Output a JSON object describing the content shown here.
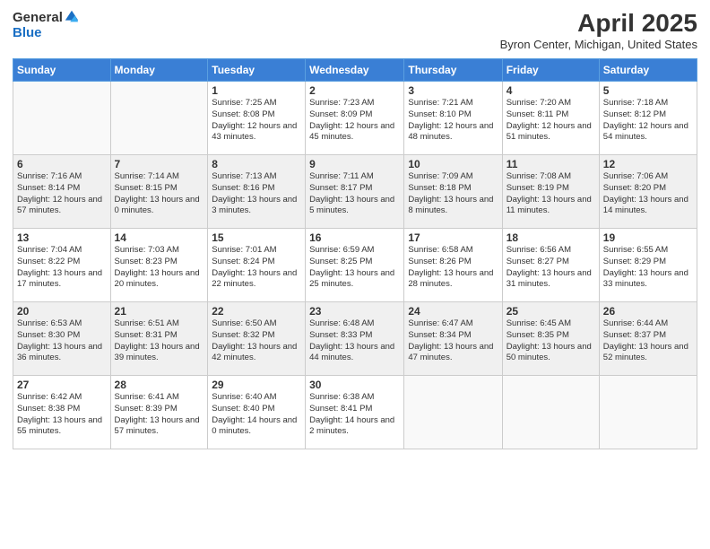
{
  "header": {
    "logo_general": "General",
    "logo_blue": "Blue",
    "title": "April 2025",
    "location": "Byron Center, Michigan, United States"
  },
  "days_of_week": [
    "Sunday",
    "Monday",
    "Tuesday",
    "Wednesday",
    "Thursday",
    "Friday",
    "Saturday"
  ],
  "weeks": [
    {
      "shaded": false,
      "days": [
        {
          "num": "",
          "info": ""
        },
        {
          "num": "",
          "info": ""
        },
        {
          "num": "1",
          "info": "Sunrise: 7:25 AM\nSunset: 8:08 PM\nDaylight: 12 hours and 43 minutes."
        },
        {
          "num": "2",
          "info": "Sunrise: 7:23 AM\nSunset: 8:09 PM\nDaylight: 12 hours and 45 minutes."
        },
        {
          "num": "3",
          "info": "Sunrise: 7:21 AM\nSunset: 8:10 PM\nDaylight: 12 hours and 48 minutes."
        },
        {
          "num": "4",
          "info": "Sunrise: 7:20 AM\nSunset: 8:11 PM\nDaylight: 12 hours and 51 minutes."
        },
        {
          "num": "5",
          "info": "Sunrise: 7:18 AM\nSunset: 8:12 PM\nDaylight: 12 hours and 54 minutes."
        }
      ]
    },
    {
      "shaded": true,
      "days": [
        {
          "num": "6",
          "info": "Sunrise: 7:16 AM\nSunset: 8:14 PM\nDaylight: 12 hours and 57 minutes."
        },
        {
          "num": "7",
          "info": "Sunrise: 7:14 AM\nSunset: 8:15 PM\nDaylight: 13 hours and 0 minutes."
        },
        {
          "num": "8",
          "info": "Sunrise: 7:13 AM\nSunset: 8:16 PM\nDaylight: 13 hours and 3 minutes."
        },
        {
          "num": "9",
          "info": "Sunrise: 7:11 AM\nSunset: 8:17 PM\nDaylight: 13 hours and 5 minutes."
        },
        {
          "num": "10",
          "info": "Sunrise: 7:09 AM\nSunset: 8:18 PM\nDaylight: 13 hours and 8 minutes."
        },
        {
          "num": "11",
          "info": "Sunrise: 7:08 AM\nSunset: 8:19 PM\nDaylight: 13 hours and 11 minutes."
        },
        {
          "num": "12",
          "info": "Sunrise: 7:06 AM\nSunset: 8:20 PM\nDaylight: 13 hours and 14 minutes."
        }
      ]
    },
    {
      "shaded": false,
      "days": [
        {
          "num": "13",
          "info": "Sunrise: 7:04 AM\nSunset: 8:22 PM\nDaylight: 13 hours and 17 minutes."
        },
        {
          "num": "14",
          "info": "Sunrise: 7:03 AM\nSunset: 8:23 PM\nDaylight: 13 hours and 20 minutes."
        },
        {
          "num": "15",
          "info": "Sunrise: 7:01 AM\nSunset: 8:24 PM\nDaylight: 13 hours and 22 minutes."
        },
        {
          "num": "16",
          "info": "Sunrise: 6:59 AM\nSunset: 8:25 PM\nDaylight: 13 hours and 25 minutes."
        },
        {
          "num": "17",
          "info": "Sunrise: 6:58 AM\nSunset: 8:26 PM\nDaylight: 13 hours and 28 minutes."
        },
        {
          "num": "18",
          "info": "Sunrise: 6:56 AM\nSunset: 8:27 PM\nDaylight: 13 hours and 31 minutes."
        },
        {
          "num": "19",
          "info": "Sunrise: 6:55 AM\nSunset: 8:29 PM\nDaylight: 13 hours and 33 minutes."
        }
      ]
    },
    {
      "shaded": true,
      "days": [
        {
          "num": "20",
          "info": "Sunrise: 6:53 AM\nSunset: 8:30 PM\nDaylight: 13 hours and 36 minutes."
        },
        {
          "num": "21",
          "info": "Sunrise: 6:51 AM\nSunset: 8:31 PM\nDaylight: 13 hours and 39 minutes."
        },
        {
          "num": "22",
          "info": "Sunrise: 6:50 AM\nSunset: 8:32 PM\nDaylight: 13 hours and 42 minutes."
        },
        {
          "num": "23",
          "info": "Sunrise: 6:48 AM\nSunset: 8:33 PM\nDaylight: 13 hours and 44 minutes."
        },
        {
          "num": "24",
          "info": "Sunrise: 6:47 AM\nSunset: 8:34 PM\nDaylight: 13 hours and 47 minutes."
        },
        {
          "num": "25",
          "info": "Sunrise: 6:45 AM\nSunset: 8:35 PM\nDaylight: 13 hours and 50 minutes."
        },
        {
          "num": "26",
          "info": "Sunrise: 6:44 AM\nSunset: 8:37 PM\nDaylight: 13 hours and 52 minutes."
        }
      ]
    },
    {
      "shaded": false,
      "days": [
        {
          "num": "27",
          "info": "Sunrise: 6:42 AM\nSunset: 8:38 PM\nDaylight: 13 hours and 55 minutes."
        },
        {
          "num": "28",
          "info": "Sunrise: 6:41 AM\nSunset: 8:39 PM\nDaylight: 13 hours and 57 minutes."
        },
        {
          "num": "29",
          "info": "Sunrise: 6:40 AM\nSunset: 8:40 PM\nDaylight: 14 hours and 0 minutes."
        },
        {
          "num": "30",
          "info": "Sunrise: 6:38 AM\nSunset: 8:41 PM\nDaylight: 14 hours and 2 minutes."
        },
        {
          "num": "",
          "info": ""
        },
        {
          "num": "",
          "info": ""
        },
        {
          "num": "",
          "info": ""
        }
      ]
    }
  ]
}
